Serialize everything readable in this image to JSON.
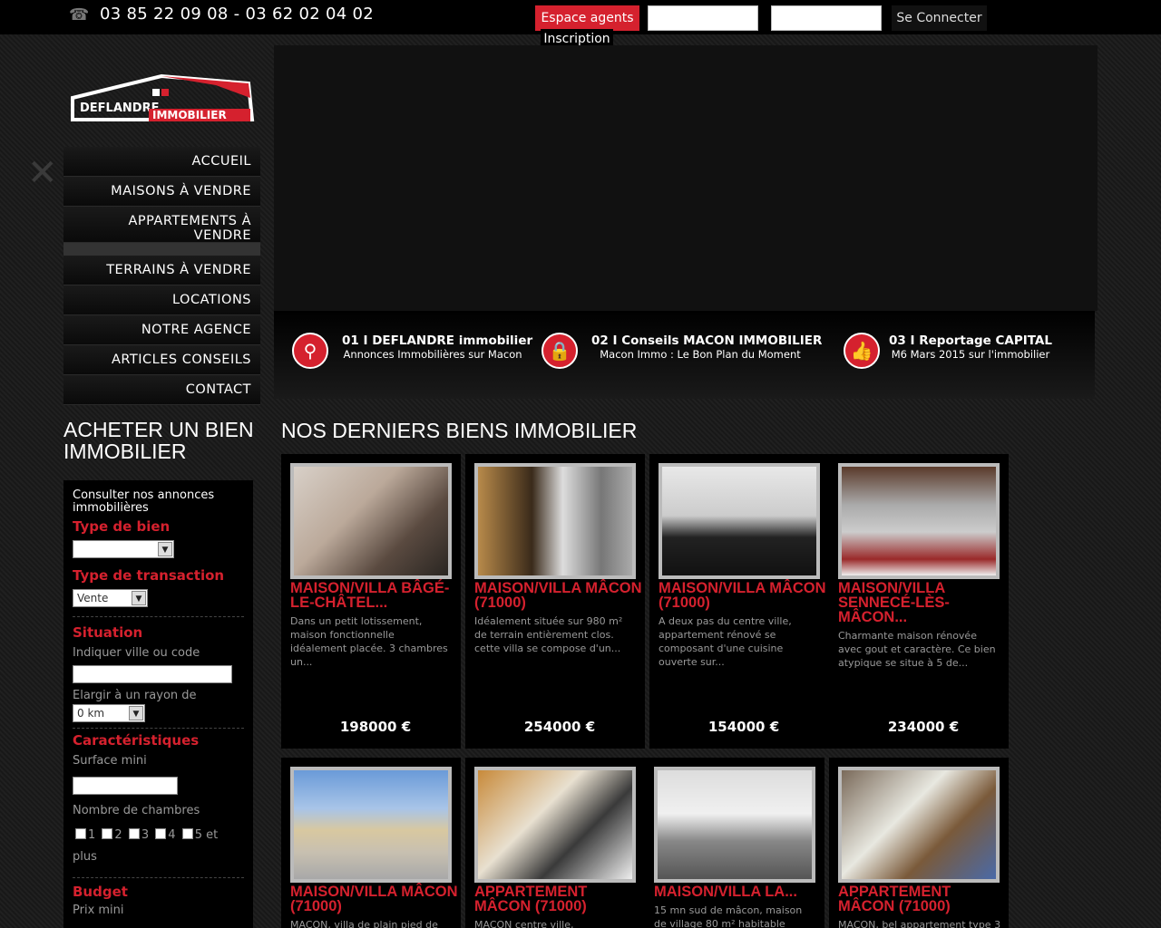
{
  "topbar": {
    "phone": "03 85 22 09 08 - 03 62 02 04 02",
    "espace_agents": "Espace agents",
    "connect": "Se Connecter",
    "inscription": "Inscription"
  },
  "logo": {
    "line1": "DEFLANDRE",
    "line2": "IMMOBILIER"
  },
  "nav": [
    "ACCUEIL",
    "MAISONS À VENDRE",
    "APPARTEMENTS À VENDRE",
    "TERRAINS À VENDRE",
    "LOCATIONS",
    "NOTRE AGENCE",
    "ARTICLES CONSEILS",
    "CONTACT"
  ],
  "side": {
    "title": "ACHETER UN BIEN IMMOBILIER",
    "intro": "Consulter nos annonces immobilières",
    "type_bien": "Type de bien",
    "type_transaction": "Type de transaction",
    "transaction_value": "Vente",
    "situation": "Situation",
    "ville_label": "Indiquer ville ou code",
    "rayon_label": "Elargir à un rayon de",
    "rayon_value": "0 km",
    "caracteristiques": "Caractéristiques",
    "surface_label": "Surface mini",
    "chambres_label": "Nombre de chambres",
    "chambres": [
      "1",
      "2",
      "3",
      "4",
      "5 et plus"
    ],
    "budget": "Budget",
    "prix_label": "Prix mini"
  },
  "features": [
    {
      "title": "01 I DEFLANDRE immobilier",
      "sub": "Annonces Immobilières sur Macon",
      "icon": "search-icon"
    },
    {
      "title": "02 I Conseils MACON IMMOBILIER",
      "sub": "Macon Immo : Le Bon Plan du Moment",
      "icon": "lock-icon"
    },
    {
      "title": "03 I Reportage CAPITAL",
      "sub": "M6 Mars 2015 sur l'immobilier",
      "icon": "thumbs-up-icon"
    }
  ],
  "main_title": "NOS DERNIERS BIENS IMMOBILIER",
  "cards": [
    {
      "title": "MAISON/VILLA BÂGÉ-LE-CHÂTEL...",
      "desc": "Dans un petit lotissement, maison fonctionnelle idéalement placée. 3 chambres un...",
      "price": "198000 €"
    },
    {
      "title": "MAISON/VILLA MÂCON (71000)",
      "desc": "Idéalement située sur 980 m² de terrain entièrement clos. cette villa se compose d'un...",
      "price": "254000 €"
    },
    {
      "title": "MAISON/VILLA MÂCON (71000)",
      "desc": "A deux pas du centre ville, appartement rénové se composant d'une cuisine ouverte sur...",
      "price": "154000 €"
    },
    {
      "title": "MAISON/VILLA SENNECÉ-LÈS-MÂCON...",
      "desc": "Charmante maison rénovée avec gout et caractère. Ce bien atypique se situe à 5 de...",
      "price": "234000 €"
    },
    {
      "title": "MAISON/VILLA MÂCON (71000)",
      "desc": "MACON, villa de plain pied de",
      "price": ""
    },
    {
      "title": "APPARTEMENT MÂCON (71000)",
      "desc": "MACON centre ville,",
      "price": ""
    },
    {
      "title": "MAISON/VILLA LA...",
      "desc": "15 mn sud de mâcon, maison de village 80 m² habitable",
      "price": ""
    },
    {
      "title": "APPARTEMENT MÂCON (71000)",
      "desc": "MACON, bel appartement type 3",
      "price": ""
    }
  ]
}
